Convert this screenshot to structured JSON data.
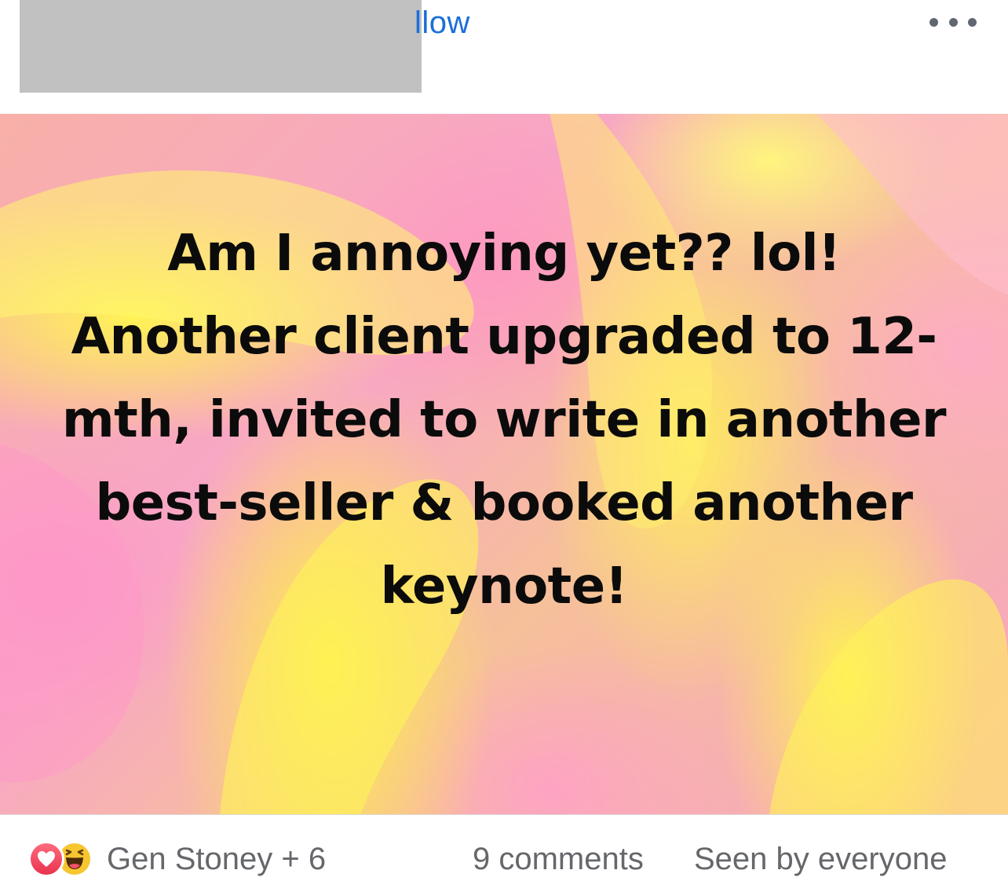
{
  "header": {
    "follow_label": "llow",
    "more_icon": "more-horizontal-icon"
  },
  "post": {
    "text": "Am I annoying yet?? lol! Another client upgraded to 12-mth, invited to write in another best-seller & booked another keynote!",
    "background_colors": [
      "#f8a6c6",
      "#fff250",
      "#f6c09a"
    ]
  },
  "footer": {
    "reaction_icons": [
      "love-icon",
      "haha-icon"
    ],
    "reaction_names": "Gen Stoney + 6",
    "comments": "9 comments",
    "seen": "Seen by everyone"
  }
}
